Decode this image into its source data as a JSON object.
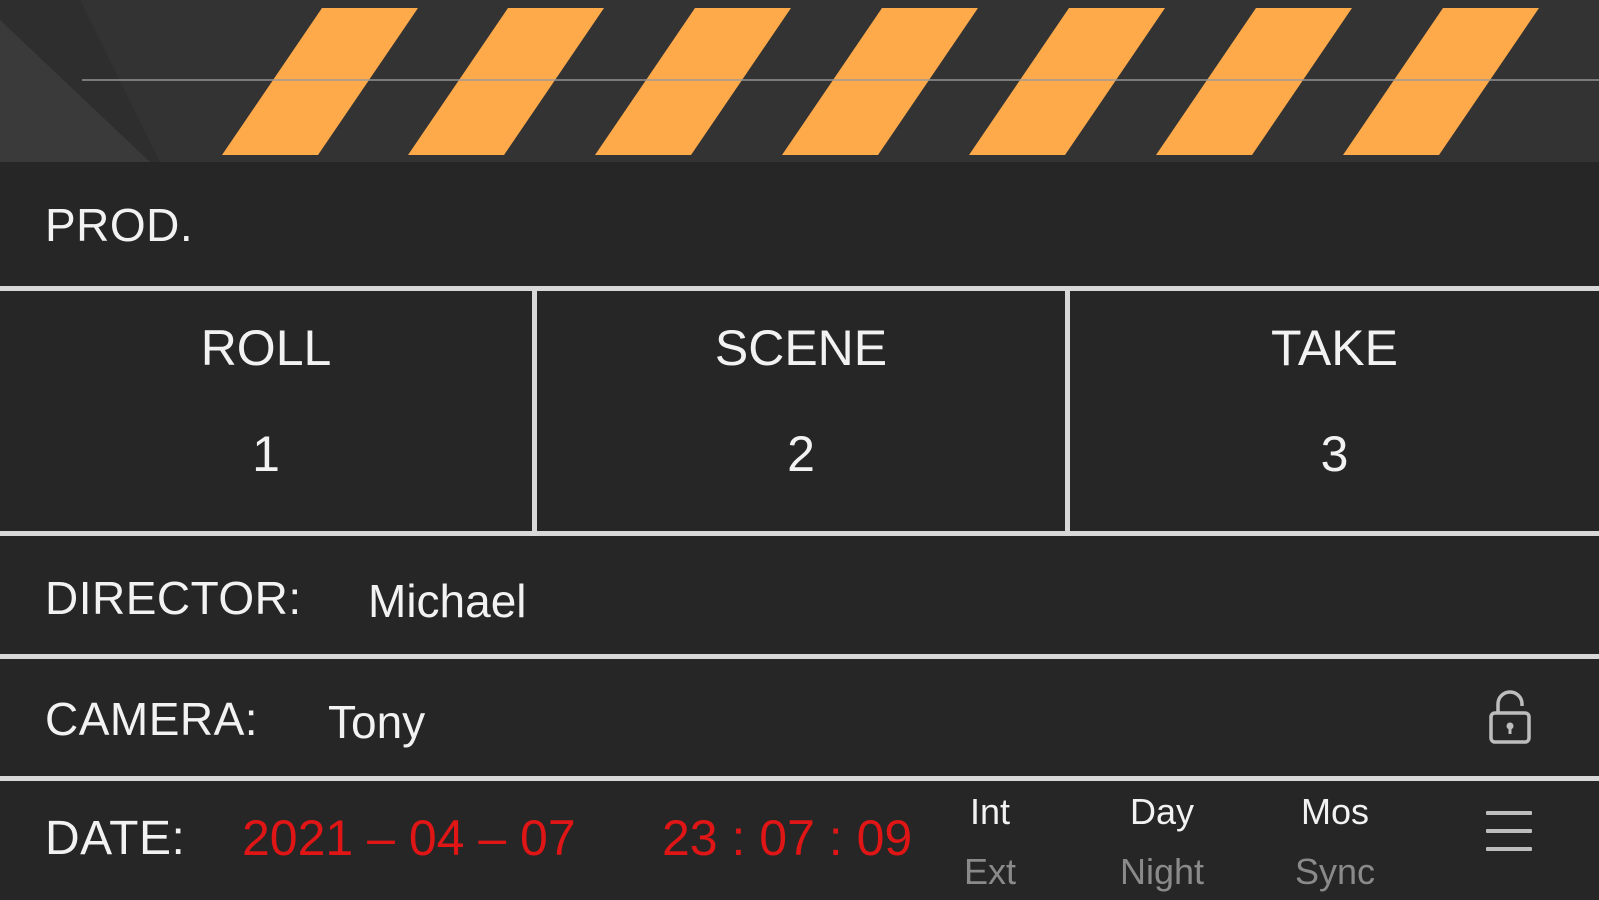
{
  "clapper": {
    "stripe_color": "#FFAA4A",
    "bar_color": "#333333"
  },
  "prod": {
    "label": "PROD."
  },
  "grid": {
    "roll": {
      "label": "ROLL",
      "value": "1"
    },
    "scene": {
      "label": "SCENE",
      "value": "2"
    },
    "take": {
      "label": "TAKE",
      "value": "3"
    }
  },
  "director": {
    "label": "DIRECTOR:",
    "value": "Michael"
  },
  "camera": {
    "label": "CAMERA:",
    "value": "Tony",
    "lock_icon": "lock-icon"
  },
  "date": {
    "label": "DATE:",
    "date_value": "2021 – 04 – 07",
    "time_value": "23 : 07 : 09",
    "value_color": "#E01515"
  },
  "toggles": {
    "int_ext": {
      "selected": "Int",
      "other": "Ext"
    },
    "day_night": {
      "selected": "Day",
      "other": "Night"
    },
    "mos_sync": {
      "selected": "Mos",
      "other": "Sync"
    }
  },
  "menu": {
    "icon": "hamburger-menu-icon"
  }
}
